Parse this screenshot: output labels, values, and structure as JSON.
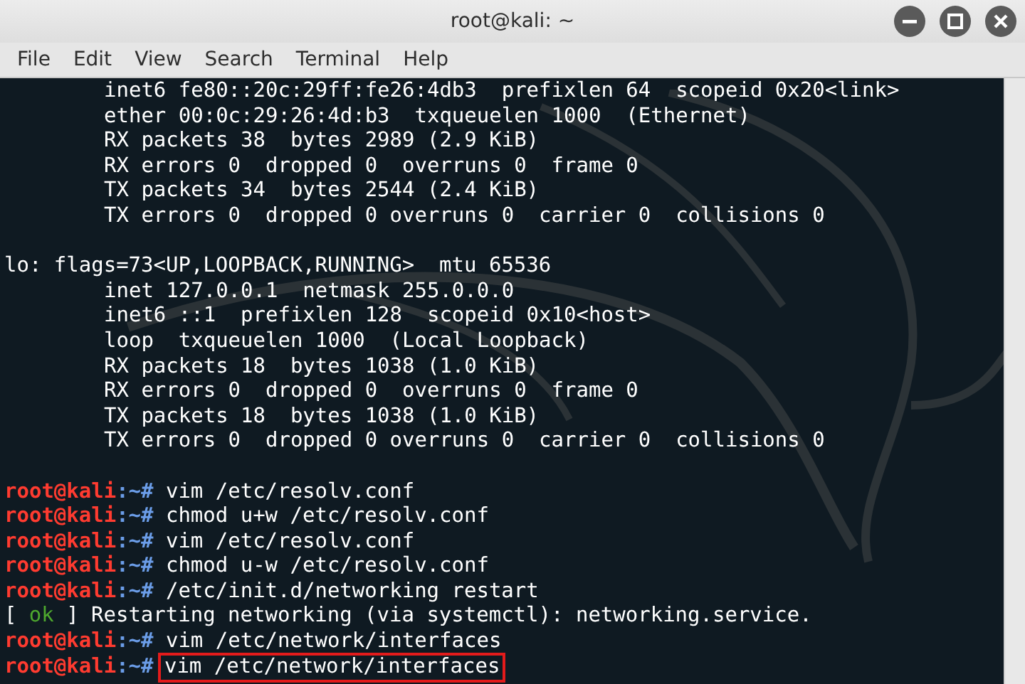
{
  "window": {
    "title": "root@kali: ~"
  },
  "menu": [
    "File",
    "Edit",
    "View",
    "Search",
    "Terminal",
    "Help"
  ],
  "lines": [
    {
      "kind": "detail",
      "text": "inet6 fe80::20c:29ff:fe26:4db3  prefixlen 64  scopeid 0x20<link>"
    },
    {
      "kind": "detail",
      "text": "ether 00:0c:29:26:4d:b3  txqueuelen 1000  (Ethernet)"
    },
    {
      "kind": "detail",
      "text": "RX packets 38  bytes 2989 (2.9 KiB)"
    },
    {
      "kind": "detail",
      "text": "RX errors 0  dropped 0  overruns 0  frame 0"
    },
    {
      "kind": "detail",
      "text": "TX packets 34  bytes 2544 (2.4 KiB)"
    },
    {
      "kind": "detail",
      "text": "TX errors 0  dropped 0 overruns 0  carrier 0  collisions 0"
    },
    {
      "kind": "blank"
    },
    {
      "kind": "header",
      "text": "lo: flags=73<UP,LOOPBACK,RUNNING>  mtu 65536"
    },
    {
      "kind": "detail",
      "text": "inet 127.0.0.1  netmask 255.0.0.0"
    },
    {
      "kind": "detail",
      "text": "inet6 ::1  prefixlen 128  scopeid 0x10<host>"
    },
    {
      "kind": "detail",
      "text": "loop  txqueuelen 1000  (Local Loopback)"
    },
    {
      "kind": "detail",
      "text": "RX packets 18  bytes 1038 (1.0 KiB)"
    },
    {
      "kind": "detail",
      "text": "RX errors 0  dropped 0  overruns 0  frame 0"
    },
    {
      "kind": "detail",
      "text": "TX packets 18  bytes 1038 (1.0 KiB)"
    },
    {
      "kind": "detail",
      "text": "TX errors 0  dropped 0 overruns 0  carrier 0  collisions 0"
    },
    {
      "kind": "blank"
    },
    {
      "kind": "prompt",
      "user": "root@kali",
      "path": ":~#",
      "command": "vim /etc/resolv.conf",
      "highlighted": false
    },
    {
      "kind": "prompt",
      "user": "root@kali",
      "path": ":~#",
      "command": "chmod u+w /etc/resolv.conf",
      "highlighted": false
    },
    {
      "kind": "prompt",
      "user": "root@kali",
      "path": ":~#",
      "command": "vim /etc/resolv.conf",
      "highlighted": false
    },
    {
      "kind": "prompt",
      "user": "root@kali",
      "path": ":~#",
      "command": "chmod u-w /etc/resolv.conf",
      "highlighted": false
    },
    {
      "kind": "prompt",
      "user": "root@kali",
      "path": ":~#",
      "command": "/etc/init.d/networking restart",
      "highlighted": false
    },
    {
      "kind": "status",
      "open": "[",
      "status": "ok",
      "close": "]",
      "text": "Restarting networking (via systemctl): networking.service."
    },
    {
      "kind": "prompt",
      "user": "root@kali",
      "path": ":~#",
      "command": "vim /etc/network/interfaces",
      "highlighted": false
    },
    {
      "kind": "prompt",
      "user": "root@kali",
      "path": ":~#",
      "command": "vim /etc/network/interfaces",
      "highlighted": true
    }
  ]
}
